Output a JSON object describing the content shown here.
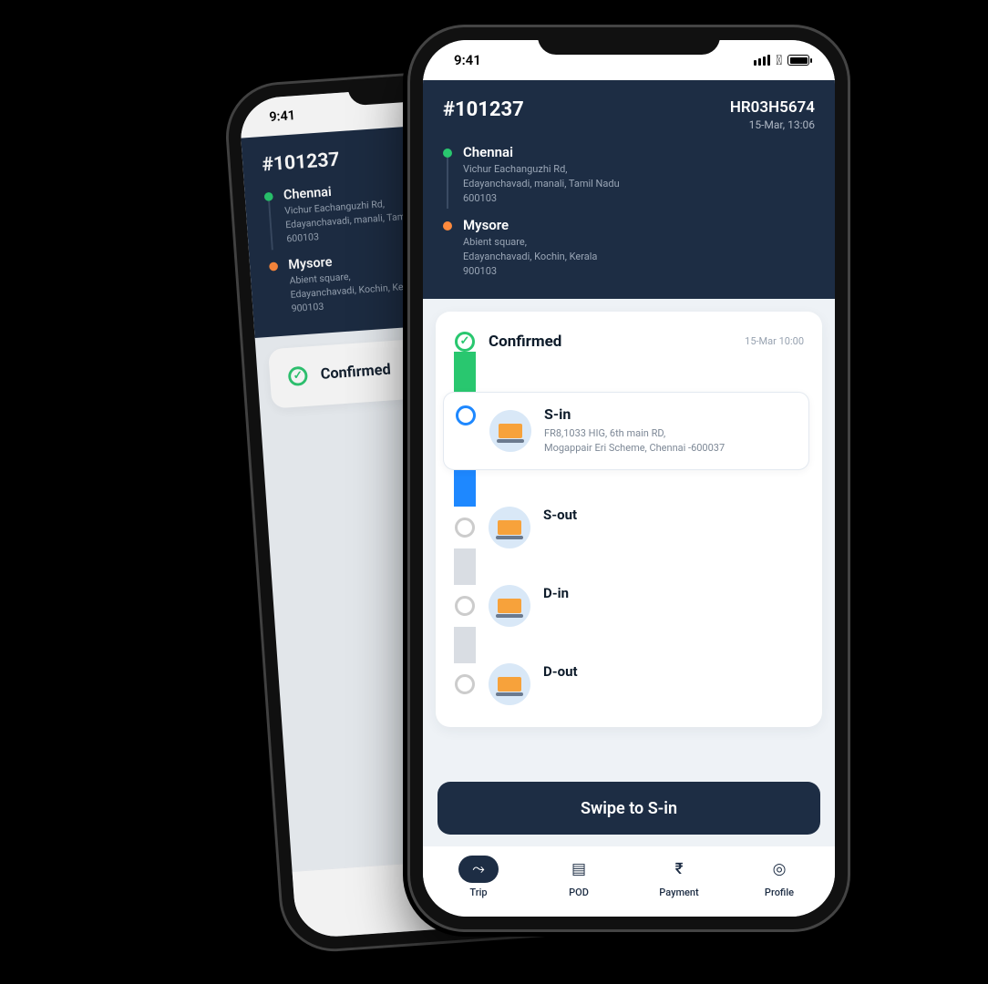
{
  "status_bar": {
    "time": "9:41"
  },
  "header": {
    "trip_id": "#101237",
    "vehicle_no": "HR03H5674",
    "timestamp": "15-Mar,  13:06",
    "origin": {
      "city": "Chennai",
      "address": "Vichur Eachanguzhi Rd,\nEdayanchavadi, manali, Tamil Nadu\n600103"
    },
    "destination": {
      "city": "Mysore",
      "address": "Abient square,\nEdayanchavadi, Kochin, Kerala\n900103"
    }
  },
  "progress": {
    "confirmed": {
      "title": "Confirmed",
      "time": "15-Mar  10:00"
    },
    "s_in": {
      "title": "S-in",
      "address": "FR8,1033 HIG, 6th main RD,\nMogappair Eri Scheme, Chennai -600037"
    },
    "s_out": {
      "title": "S-out"
    },
    "d_in": {
      "title": "D-in"
    },
    "d_out": {
      "title": "D-out"
    }
  },
  "swipe_button": "Swipe to S-in",
  "nav": {
    "trip": "Trip",
    "pod": "POD",
    "payment": "Payment",
    "profile": "Profile"
  }
}
